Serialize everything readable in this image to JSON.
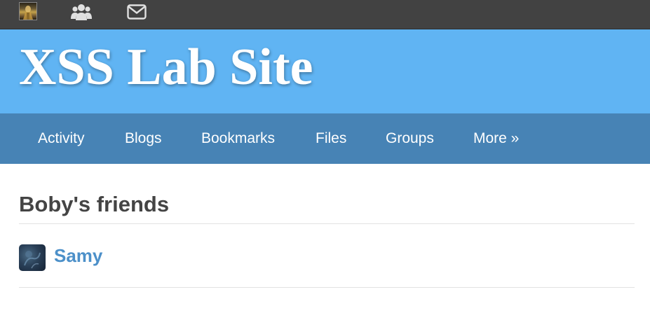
{
  "topbar": {
    "icons": [
      "user-avatar",
      "friends-icon",
      "messages-icon"
    ]
  },
  "header": {
    "site_title": "XSS Lab Site"
  },
  "nav": {
    "items": [
      {
        "label": "Activity"
      },
      {
        "label": "Blogs"
      },
      {
        "label": "Bookmarks"
      },
      {
        "label": "Files"
      },
      {
        "label": "Groups"
      },
      {
        "label": "More »"
      }
    ]
  },
  "main": {
    "title": "Boby's friends",
    "friends": [
      {
        "name": "Samy"
      }
    ]
  },
  "colors": {
    "topbar": "#424242",
    "header": "#60b4f3",
    "nav": "#4783b5",
    "link": "#4c90c9",
    "title": "#444444"
  }
}
